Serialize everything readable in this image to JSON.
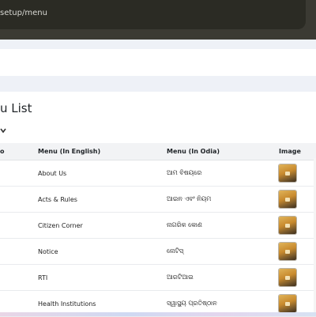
{
  "browser": {
    "url_fragment": "setup/menu"
  },
  "page": {
    "title": "u List",
    "length_select_value": "",
    "length_select_icon": "chevron-down-icon"
  },
  "table": {
    "headers": {
      "no": "o",
      "english": "Menu (In English)",
      "odia": "Menu (In Odia)",
      "image": "Image"
    },
    "rows": [
      {
        "english": "About Us",
        "odia": "ଆମ ବିଷୟରେ"
      },
      {
        "english": "Acts & Rules",
        "odia": "ଆଇନ ଏବଂ ନିୟମ"
      },
      {
        "english": "Citizen Corner",
        "odia": "ନାଗରିକ କୋଣ"
      },
      {
        "english": "Notice",
        "odia": "ନୋଟିସ୍"
      },
      {
        "english": "RTI",
        "odia": "ଆରଟିଆଇ"
      },
      {
        "english": "Health Institutions",
        "odia": "ସ୍ୱାସ୍ଥ୍ୟ ପ୍ରତିଷ୍ଠାନ"
      }
    ]
  }
}
